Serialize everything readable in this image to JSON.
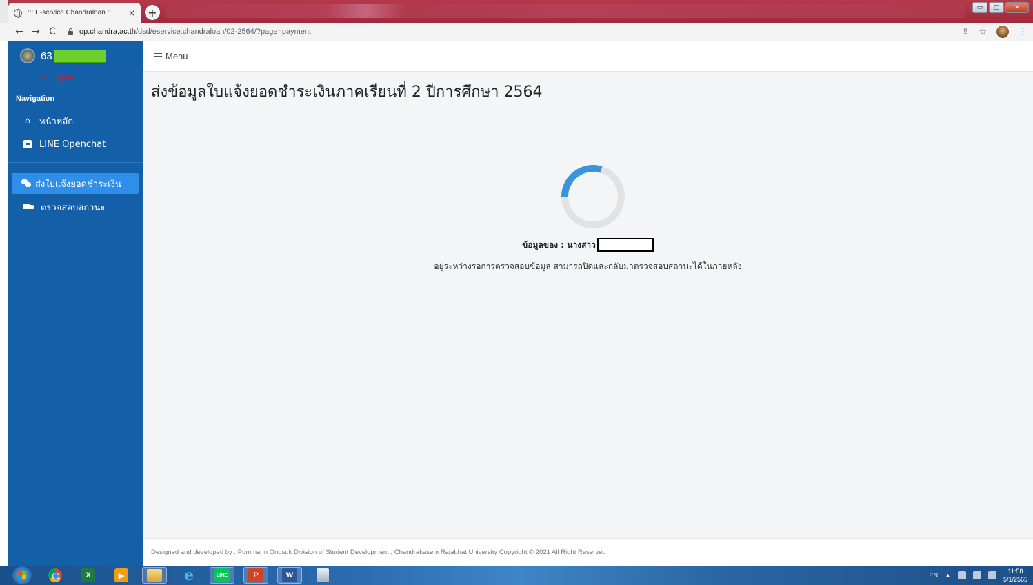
{
  "browser": {
    "tab_title": "::: E-service Chandraloan :::",
    "tab_close": "×",
    "new_tab": "+",
    "url_host": "op.chandra.ac.th",
    "url_path": "/dsd/eservice.chandraloan/02-2564/?page=payment",
    "nav_back": "←",
    "nav_forward": "→",
    "nav_reload": "C",
    "win_minimize": "▭",
    "win_maximize": "▢",
    "win_close": "✕",
    "share_icon": "⇪",
    "star_icon": "☆",
    "more_icon": "⋮"
  },
  "sidebar": {
    "user_id": "63",
    "logout_label": "Logout",
    "nav_heading": "Navigation",
    "items": [
      {
        "label": "หน้าหลัก",
        "icon": "home-icon"
      },
      {
        "label": "LINE Openchat",
        "icon": "line-icon"
      },
      {
        "label": "ส่งใบแจ้งยอดชำระเงิน",
        "icon": "chat-icon",
        "active": true
      },
      {
        "label": "ตรวจสอบสถานะ",
        "icon": "truck-icon"
      }
    ]
  },
  "topbar": {
    "menu_label": "Menu"
  },
  "main": {
    "title": "ส่งข้อมูลใบแจ้งยอดชำระเงินภาคเรียนที่ 2 ปีการศึกษา 2564",
    "data_of_label": "ข้อมูลของ : นางสาว",
    "status_text": "อยู่ระหว่างรอการตรวจสอบข้อมูล สามารถปิดและกลับมาตรวจสอบสถานะได้ในภายหลัง",
    "spinner_color": "#3a95dc",
    "spinner_track_color": "#e2e2e2"
  },
  "footer": {
    "text": "Designed and developed by : Pummarin Ongsuk Division of Student Development , Chandrakasem Rajabhat University Copyright © 2021 All Right Reserved"
  },
  "taskbar": {
    "lang": "EN",
    "tray_arrow": "▲",
    "time": "11:58",
    "date": "5/1/2565",
    "excel_letter": "X",
    "ppt_letter": "P",
    "word_letter": "W",
    "line_label": "LINE"
  },
  "colors": {
    "sidebar_bg": "#1360a8",
    "active_item_bg": "#2f8ee9",
    "content_bg": "#f4f5f7",
    "logout_color": "#c0263a",
    "redact_green": "#6ccf2a"
  }
}
